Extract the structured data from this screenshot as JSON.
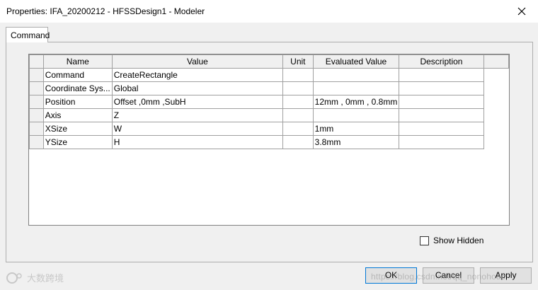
{
  "window": {
    "title": "Properties: IFA_20200212 - HFSSDesign1 - Modeler",
    "close_icon": "close-icon"
  },
  "tabs": [
    {
      "label": "Command",
      "active": true
    }
  ],
  "grid": {
    "columns": [
      "Name",
      "Value",
      "Unit",
      "Evaluated Value",
      "Description"
    ],
    "rows": [
      {
        "name": "Command",
        "value": "CreateRectangle",
        "unit": "",
        "evaluated": "",
        "description": ""
      },
      {
        "name": "Coordinate Sys...",
        "value": "Global",
        "unit": "",
        "evaluated": "",
        "description": ""
      },
      {
        "name": "Position",
        "value": "Offset ,0mm ,SubH",
        "unit": "",
        "evaluated": "12mm , 0mm , 0.8mm",
        "description": ""
      },
      {
        "name": "Axis",
        "value": "Z",
        "unit": "",
        "evaluated": "",
        "description": ""
      },
      {
        "name": "XSize",
        "value": "W",
        "unit": "",
        "evaluated": "1mm",
        "description": ""
      },
      {
        "name": "YSize",
        "value": "H",
        "unit": "",
        "evaluated": "3.8mm",
        "description": ""
      }
    ]
  },
  "show_hidden": {
    "label": "Show Hidden",
    "checked": false
  },
  "buttons": {
    "ok": "OK",
    "cancel": "Cancel",
    "apply": "Apply"
  },
  "watermark": {
    "logo_text": "大数跨境",
    "url": "https://blog.csdn.net/qq_nonohoac"
  },
  "colors": {
    "accent": "#0078d7",
    "panel": "#f0f0f0",
    "grid_line": "#a0a0a0"
  }
}
